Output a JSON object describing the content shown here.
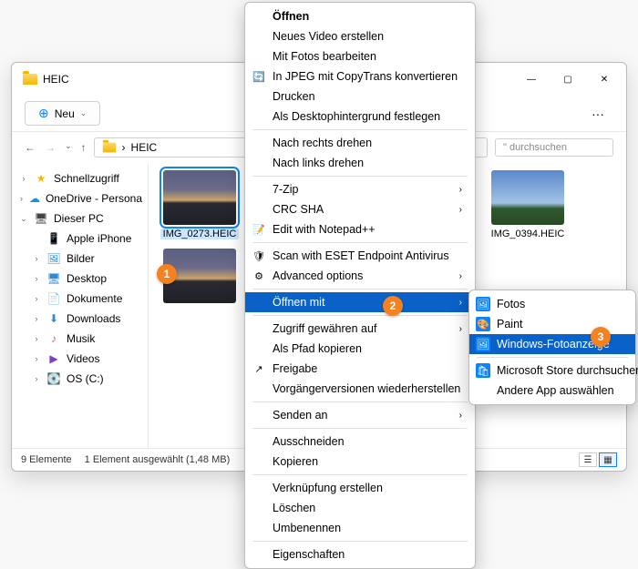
{
  "window": {
    "title": "HEIC",
    "new_btn": "Neu",
    "more": "···",
    "min": "—",
    "max": "▢",
    "close": "✕"
  },
  "nav": {
    "back": "←",
    "fwd": "→",
    "up": "↑",
    "path_label": "HEIC",
    "path_sep": "›",
    "search_placeholder": "\" durchsuchen"
  },
  "sidebar": [
    {
      "chev": "›",
      "icon": "★",
      "label": "Schnellzugriff",
      "color": "#f5b800"
    },
    {
      "chev": "›",
      "icon": "☁",
      "label": "OneDrive - Persona",
      "color": "#1a90d8"
    },
    {
      "chev": "⌄",
      "icon": "🖥",
      "label": "Dieser PC",
      "color": "#444"
    },
    {
      "chev": "",
      "icon": "📱",
      "label": "Apple iPhone",
      "color": "#555",
      "indent": 1
    },
    {
      "chev": "›",
      "icon": "🖼",
      "label": "Bilder",
      "color": "#2e8bd8",
      "indent": 1
    },
    {
      "chev": "›",
      "icon": "🖥",
      "label": "Desktop",
      "color": "#2e8bd8",
      "indent": 1
    },
    {
      "chev": "›",
      "icon": "📄",
      "label": "Dokumente",
      "color": "#555",
      "indent": 1
    },
    {
      "chev": "›",
      "icon": "⬇",
      "label": "Downloads",
      "color": "#2e8bd8",
      "indent": 1
    },
    {
      "chev": "›",
      "icon": "♪",
      "label": "Musik",
      "color": "#d84e9e",
      "indent": 1
    },
    {
      "chev": "›",
      "icon": "▶",
      "label": "Videos",
      "color": "#7a3fc9",
      "indent": 1
    },
    {
      "chev": "›",
      "icon": "💽",
      "label": "OS (C:)",
      "color": "#555",
      "indent": 1
    }
  ],
  "files": [
    {
      "name": "IMG_0273.HEIC",
      "thumb": "sunset",
      "selected": true
    },
    {
      "name": "",
      "thumb": "sky"
    },
    {
      "name": "",
      "thumb": "sunset"
    },
    {
      "name": "IMG_0394.HEIC",
      "thumb": "sky"
    },
    {
      "name": "",
      "thumb": "sunset"
    }
  ],
  "status": {
    "count": "9 Elemente",
    "sel": "1 Element ausgewählt (1,48 MB)"
  },
  "ctx1": [
    {
      "t": "item",
      "label": "Öffnen",
      "bold": true
    },
    {
      "t": "item",
      "label": "Neues Video erstellen"
    },
    {
      "t": "item",
      "label": "Mit Fotos bearbeiten"
    },
    {
      "t": "item",
      "label": "In JPEG mit CopyTrans konvertieren",
      "icon": "🔄"
    },
    {
      "t": "item",
      "label": "Drucken"
    },
    {
      "t": "item",
      "label": "Als Desktophintergrund festlegen"
    },
    {
      "t": "sep"
    },
    {
      "t": "item",
      "label": "Nach rechts drehen"
    },
    {
      "t": "item",
      "label": "Nach links drehen"
    },
    {
      "t": "sep"
    },
    {
      "t": "item",
      "label": "7-Zip",
      "sub": "›"
    },
    {
      "t": "item",
      "label": "CRC SHA",
      "sub": "›"
    },
    {
      "t": "item",
      "label": "Edit with Notepad++",
      "icon": "📝"
    },
    {
      "t": "sep"
    },
    {
      "t": "item",
      "label": "Scan with ESET Endpoint Antivirus",
      "icon": "🛡"
    },
    {
      "t": "item",
      "label": "Advanced options",
      "sub": "›",
      "icon": "⚙"
    },
    {
      "t": "sep"
    },
    {
      "t": "item",
      "label": "Öffnen mit",
      "sub": "›",
      "hl": true
    },
    {
      "t": "sep"
    },
    {
      "t": "item",
      "label": "Zugriff gewähren auf",
      "sub": "›"
    },
    {
      "t": "item",
      "label": "Als Pfad kopieren"
    },
    {
      "t": "item",
      "label": "Freigabe",
      "icon": "↗"
    },
    {
      "t": "item",
      "label": "Vorgängerversionen wiederherstellen"
    },
    {
      "t": "sep"
    },
    {
      "t": "item",
      "label": "Senden an",
      "sub": "›"
    },
    {
      "t": "sep"
    },
    {
      "t": "item",
      "label": "Ausschneiden"
    },
    {
      "t": "item",
      "label": "Kopieren"
    },
    {
      "t": "sep"
    },
    {
      "t": "item",
      "label": "Verknüpfung erstellen"
    },
    {
      "t": "item",
      "label": "Löschen"
    },
    {
      "t": "item",
      "label": "Umbenennen"
    },
    {
      "t": "sep"
    },
    {
      "t": "item",
      "label": "Eigenschaften"
    }
  ],
  "ctx2": [
    {
      "t": "item",
      "label": "Fotos",
      "icon": "🖼",
      "iconbg": true
    },
    {
      "t": "item",
      "label": "Paint",
      "icon": "🎨",
      "iconbg": true
    },
    {
      "t": "item",
      "label": "Windows-Fotoanzeige",
      "icon": "🖼",
      "iconbg": true,
      "hl": true
    },
    {
      "t": "sep"
    },
    {
      "t": "item",
      "label": "Microsoft Store durchsuchen",
      "icon": "🛍",
      "iconbg": true
    },
    {
      "t": "item",
      "label": "Andere App auswählen"
    }
  ],
  "badges": {
    "1": "1",
    "2": "2",
    "3": "3"
  }
}
